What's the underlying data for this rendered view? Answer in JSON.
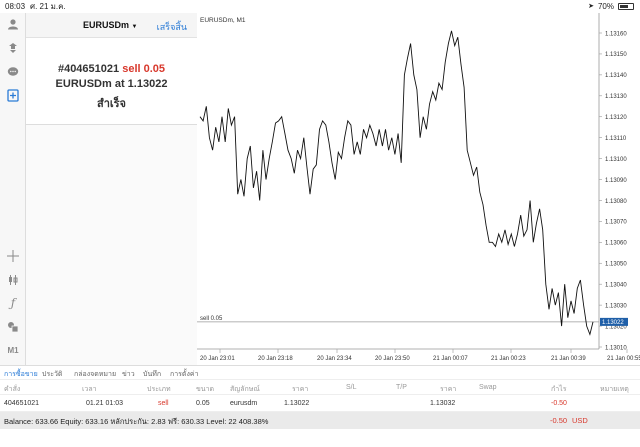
{
  "status": {
    "time": "08:03",
    "date": "ศ. 21 ม.ค.",
    "battery_text": "70%",
    "battery_level_percent": 70
  },
  "panel": {
    "symbol": "EURUSDm",
    "done_label": "เสร็จสิ้น",
    "order_number": "#404651021",
    "side": "sell",
    "volume": "0.05",
    "line2": "EURUSDm at 1.13022",
    "result": "สำเร็จ"
  },
  "left_icons": [
    "account-icon",
    "trade-icon",
    "chat-icon",
    "new-order-icon",
    "crosshair-icon",
    "candles-icon",
    "function-icon",
    "objects-icon",
    "timeframe-icon"
  ],
  "timeframe_label": "M1",
  "chart_data": {
    "type": "line",
    "title": "EURUSDm, M1",
    "x_tick_labels": [
      "20 Jan 23:01",
      "20 Jan 23:18",
      "20 Jan 23:34",
      "20 Jan 23:50",
      "21 Jan 00:07",
      "21 Jan 00:23",
      "21 Jan 00:39",
      "21 Jan 00:55"
    ],
    "y_tick_labels": [
      "1.13160",
      "1.13150",
      "1.13140",
      "1.13130",
      "1.13120",
      "1.13110",
      "1.13100",
      "1.13090",
      "1.13080",
      "1.13070",
      "1.13060",
      "1.13050",
      "1.13040",
      "1.13030",
      "1.13020",
      "1.13010"
    ],
    "ylim": [
      1.13003,
      1.13166
    ],
    "series": [
      {
        "values": [
          1.1312,
          1.13118,
          1.13125,
          1.1311,
          1.13104,
          1.13115,
          1.13108,
          1.1312,
          1.13108,
          1.13124,
          1.13116,
          1.1312,
          1.13083,
          1.1309,
          1.13082,
          1.131,
          1.13106,
          1.13086,
          1.13094,
          1.1308,
          1.13104,
          1.1309,
          1.131,
          1.13108,
          1.13117,
          1.13118,
          1.1312,
          1.13112,
          1.13104,
          1.131,
          1.13093,
          1.13104,
          1.131,
          1.1311,
          1.13096,
          1.13083,
          1.13095,
          1.13097,
          1.13114,
          1.13118,
          1.13116,
          1.13108,
          1.13098,
          1.1309,
          1.13103,
          1.131,
          1.1311,
          1.13118,
          1.13116,
          1.13102,
          1.13108,
          1.13102,
          1.13114,
          1.1311,
          1.13116,
          1.13112,
          1.13106,
          1.13114,
          1.13106,
          1.13114,
          1.13104,
          1.1311,
          1.13102,
          1.13112,
          1.13098,
          1.1314,
          1.13148,
          1.13155,
          1.1314,
          1.13133,
          1.1311,
          1.1312,
          1.13114,
          1.13126,
          1.13132,
          1.13128,
          1.13136,
          1.13133,
          1.13146,
          1.13155,
          1.13161,
          1.13154,
          1.13158,
          1.13145,
          1.13134,
          1.13104,
          1.13098,
          1.13092,
          1.13096,
          1.13084,
          1.13078,
          1.13068,
          1.1306,
          1.1306,
          1.13058,
          1.13064,
          1.1306,
          1.13066,
          1.13059,
          1.13064,
          1.13058,
          1.13064,
          1.13073,
          1.13063,
          1.13066,
          1.1308,
          1.1306,
          1.13069,
          1.13076,
          1.13066,
          1.1304,
          1.13028,
          1.13038,
          1.1303,
          1.13036,
          1.1302,
          1.1304,
          1.13024,
          1.13032,
          1.13026,
          1.13038,
          1.13042,
          1.1303,
          1.1302,
          1.13016,
          1.13022
        ]
      }
    ],
    "order_line": {
      "label": "sell 0.05",
      "value": 1.13022,
      "value_label": "1.13022"
    },
    "grid": false
  },
  "tabs": [
    "การซื้อขาย",
    "ประวัติ",
    "กล่องจดหมาย",
    "ข่าว",
    "บันทึก",
    "การตั้งค่า"
  ],
  "table": {
    "headers": [
      "คำสั่ง",
      "เวลา",
      "ประเภท",
      "ขนาด",
      "สัญลักษณ์",
      "ราคา",
      "S/L",
      "T/P",
      "ราคา",
      "Swap",
      "กำไร",
      "หมายเหตุ"
    ],
    "row": {
      "order": "404651021",
      "time": "01.21 01:03",
      "type": "sell",
      "size": "0.05",
      "symbol": "eurusdm",
      "price": "1.13022",
      "current_price": "1.13032",
      "profit": "-0.50"
    }
  },
  "balance": {
    "text": "Balance: 633.66 Equity: 633.16 หลักประกัน: 2.83 ฟรี: 630.33 Level: 22 408.38%",
    "profit": "-0.50",
    "currency": "USD"
  },
  "colors": {
    "accent": "#2a7bd6",
    "sell": "#d8382c",
    "line": "#111111",
    "order_line": "#9a9a9a"
  }
}
